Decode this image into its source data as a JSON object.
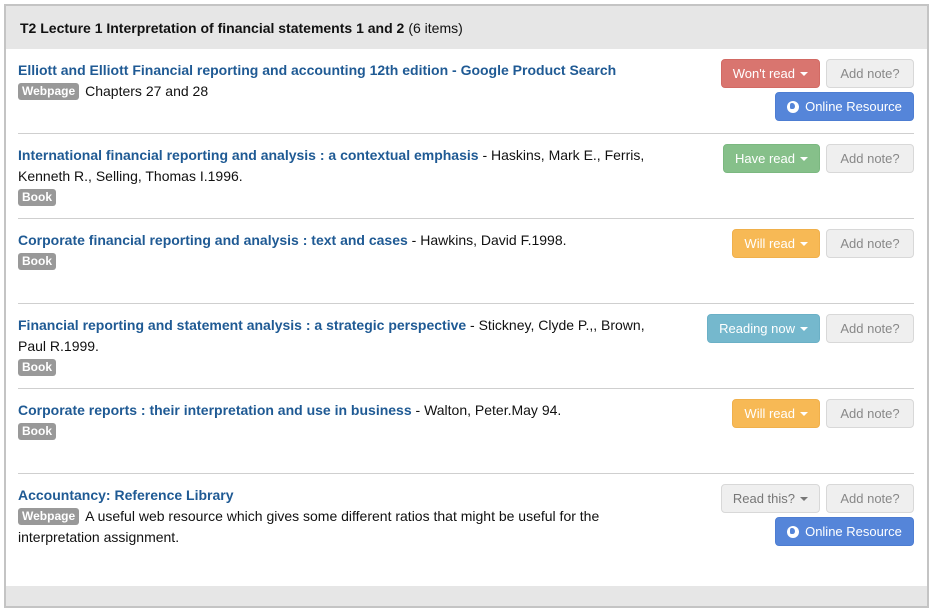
{
  "header": {
    "title": "T2 Lecture 1 Interpretation of financial statements 1 and 2",
    "count": "(6 items)"
  },
  "colors": {
    "link": "#1f5a94",
    "wont_read": "#d9756f",
    "have_read": "#86c08a",
    "will_read": "#f7b955",
    "reading_now": "#75b8cd",
    "online_resource": "#5585d9",
    "badge": "#999999"
  },
  "items": [
    {
      "title": "Elliott and Elliott Financial reporting and accounting 12th edition - Google Product Search",
      "authors": "",
      "badge": "Webpage",
      "note": "Chapters 27 and 28",
      "status": "Won't read",
      "note_button": "Add note?",
      "online_button": "Online Resource"
    },
    {
      "title": "International financial reporting and analysis : a contextual emphasis",
      "authors": " - Haskins, Mark E., Ferris, Kenneth R., Selling, Thomas I.1996.",
      "badge": "Book",
      "status": "Have read",
      "note_button": "Add note?"
    },
    {
      "title": "Corporate financial reporting and analysis : text and cases",
      "authors": " - Hawkins, David F.1998.",
      "badge": "Book",
      "status": "Will read",
      "note_button": "Add note?"
    },
    {
      "title": "Financial reporting and statement analysis : a strategic perspective",
      "authors": " - Stickney, Clyde P.,, Brown, Paul R.1999.",
      "badge": "Book",
      "status": "Reading now",
      "note_button": "Add note?"
    },
    {
      "title": "Corporate reports : their interpretation and use in business",
      "authors": " - Walton, Peter.May 94.",
      "badge": "Book",
      "status": "Will read",
      "note_button": "Add note?"
    },
    {
      "title": "Accountancy: Reference Library",
      "authors": "",
      "badge": "Webpage",
      "note": "A useful web resource which gives some different ratios that might be useful for the interpretation assignment.",
      "status": "Read this?",
      "note_button": "Add note?",
      "online_button": "Online Resource"
    }
  ]
}
